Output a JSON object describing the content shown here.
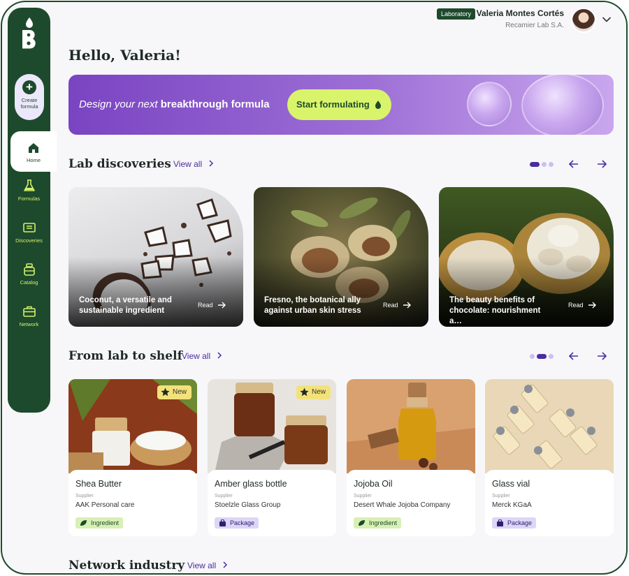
{
  "sidebar": {
    "create_label": "Create formula",
    "items": [
      {
        "label": "Home",
        "icon": "home-icon"
      },
      {
        "label": "Formulas",
        "icon": "flask-icon"
      },
      {
        "label": "Discoveries",
        "icon": "discoveries-icon"
      },
      {
        "label": "Catalog",
        "icon": "jar-icon"
      },
      {
        "label": "Network",
        "icon": "briefcase-icon"
      }
    ]
  },
  "header": {
    "role_badge": "Laboratory",
    "user_name": "Valeria Montes Cortés",
    "company": "Recamier Lab S.A."
  },
  "greeting": "Hello, Valeria!",
  "hero": {
    "text_prefix": "Design your next",
    "text_bold": "breakthrough formula",
    "button_label": "Start formulating"
  },
  "discoveries": {
    "title": "Lab discoveries",
    "view_all": "View all",
    "cards": [
      {
        "caption": "Coconut, a versatile and sustainable ingredient",
        "read": "Read"
      },
      {
        "caption": "Fresno, the botanical ally against urban skin stress",
        "read": "Read"
      },
      {
        "caption": "The beauty benefits of chocolate: nourishment a…",
        "read": "Read"
      }
    ]
  },
  "shelf": {
    "title": "From lab to shelf",
    "view_all": "View all",
    "products": [
      {
        "name": "Shea Butter",
        "supplier_label": "Supplier",
        "supplier": "AAK Personal care",
        "tag": "Ingredient",
        "badge": "New"
      },
      {
        "name": "Amber glass bottle",
        "supplier_label": "Supplier",
        "supplier": "Stoelzle Glass Group",
        "tag": "Package",
        "badge": "New"
      },
      {
        "name": "Jojoba Oil",
        "supplier_label": "Supplier",
        "supplier": "Desert Whale Jojoba Company",
        "tag": "Ingredient"
      },
      {
        "name": "Glass vial",
        "supplier_label": "Supplier",
        "supplier": "Merck KGaA",
        "tag": "Package"
      }
    ]
  },
  "network": {
    "title": "Network industry",
    "view_all": "View all"
  },
  "colors": {
    "brand_green": "#1d4a2c",
    "accent_lime": "#d9f46b",
    "accent_purple": "#4b2ca0"
  }
}
